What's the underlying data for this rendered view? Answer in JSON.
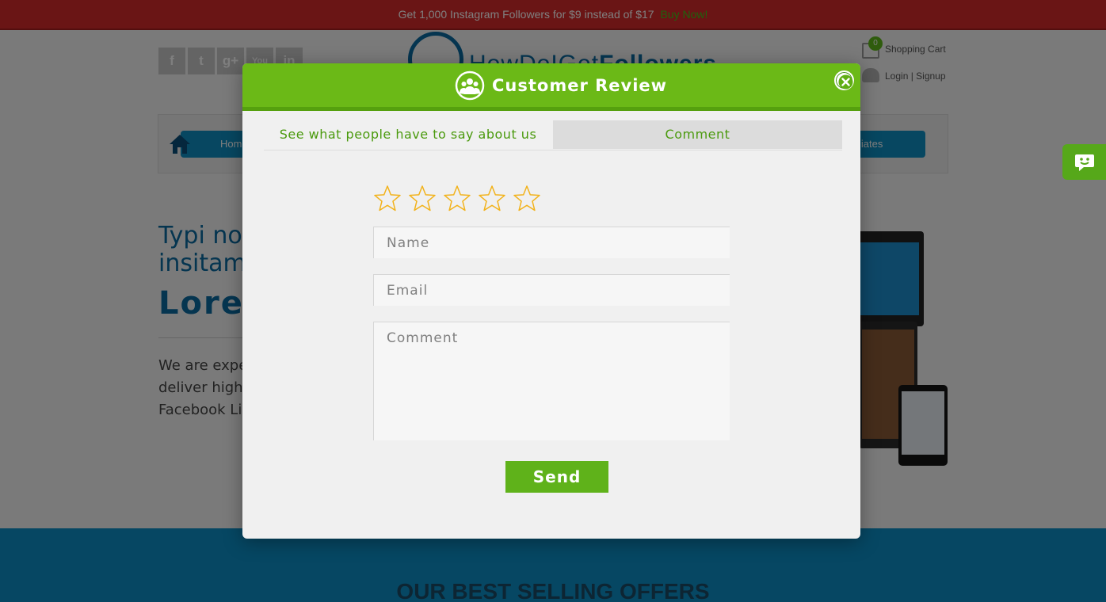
{
  "promo": {
    "text": "Get 1,000 Instagram Followers for $9 instead of $17",
    "cta": "Buy Now!"
  },
  "header": {
    "social": [
      "f",
      "t",
      "g+",
      "You",
      "in"
    ],
    "logo_text_a": "HowDoIGet",
    "logo_text_b": "Followers",
    "cart_count": "0",
    "cart_label": "Shopping Cart",
    "login_label": "Login | Signup"
  },
  "nav": {
    "home_label": "Hom",
    "affiliates_label": "liates"
  },
  "hero": {
    "line1a": "Typi no",
    "line1b": "insitam",
    "line2": "Lorer",
    "para1": "We are expe",
    "para2": "deliver high",
    "para3": "Facebook Li"
  },
  "footer": {
    "title": "OUR BEST SELLING OFFERS"
  },
  "modal": {
    "title": "Customer Review",
    "tabs": [
      {
        "label": "See what people have to say about us"
      },
      {
        "label": "Comment"
      }
    ],
    "rating": {
      "max": 5,
      "value": 0
    },
    "name_placeholder": "Name",
    "email_placeholder": "Email",
    "comment_placeholder": "Comment",
    "send_label": "Send"
  },
  "colors": {
    "brand_green": "#6bb917",
    "brand_blue": "#0a6aa1",
    "promo_red": "#d42a2a",
    "star_gold": "#f2b21a"
  },
  "icons": {
    "modal_header": "users-icon",
    "close": "close-icon",
    "star": "star-outline-icon",
    "chat": "chat-icon",
    "home": "home-icon",
    "cart": "cart-icon",
    "user": "user-icon"
  }
}
